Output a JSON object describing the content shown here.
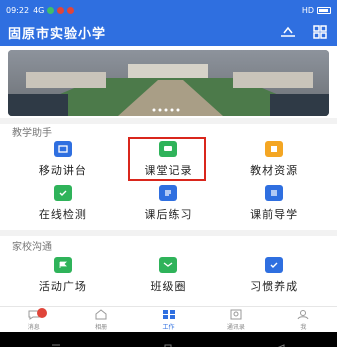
{
  "status": {
    "time": "09:22",
    "signal": "4G",
    "right_label": "HD"
  },
  "header": {
    "title": "固原市实验小学",
    "colors": {
      "bg": "#2f6fe0"
    }
  },
  "banner": {
    "alt": "school campus aerial photo"
  },
  "sections": [
    {
      "title": "教学助手",
      "items": [
        {
          "label": "移动讲台",
          "icon": "tv-icon",
          "color": "#2f6fe0"
        },
        {
          "label": "课堂记录",
          "icon": "chat-icon",
          "color": "#2fb35a"
        },
        {
          "label": "教材资源",
          "icon": "book-icon",
          "color": "#f4a623"
        },
        {
          "label": "在线检测",
          "icon": "check-icon",
          "color": "#2fb35a"
        },
        {
          "label": "课后练习",
          "icon": "doc-icon",
          "color": "#2f6fe0"
        },
        {
          "label": "课前导学",
          "icon": "guide-icon",
          "color": "#2f6fe0"
        }
      ]
    },
    {
      "title": "家校沟通",
      "items": [
        {
          "label": "活动广场",
          "icon": "flag-icon",
          "color": "#2fb35a"
        },
        {
          "label": "班级圈",
          "icon": "circle-icon",
          "color": "#2fb35a"
        },
        {
          "label": "习惯养成",
          "icon": "habit-icon",
          "color": "#2f6fe0"
        }
      ]
    }
  ],
  "bottom_nav": [
    {
      "label": "消息",
      "icon": "message-icon",
      "active": false
    },
    {
      "label": "相册",
      "icon": "home-icon",
      "active": false
    },
    {
      "label": "工作",
      "icon": "work-icon",
      "active": true
    },
    {
      "label": "通讯录",
      "icon": "contacts-icon",
      "active": false
    },
    {
      "label": "我",
      "icon": "profile-icon",
      "active": false
    }
  ]
}
